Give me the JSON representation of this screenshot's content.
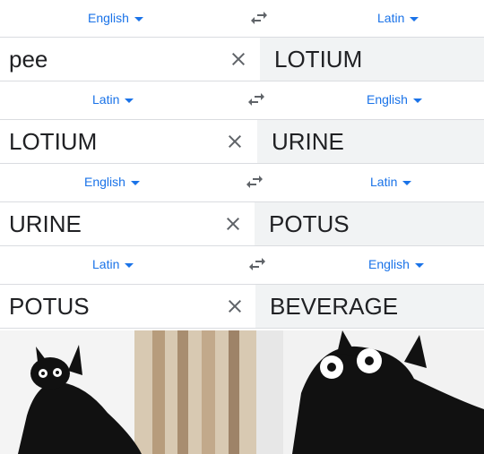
{
  "rows": [
    {
      "source_lang": "English",
      "target_lang": "Latin",
      "source_text": "pee",
      "translation": "LOTIUM"
    },
    {
      "source_lang": "Latin",
      "target_lang": "English",
      "source_text": "LOTIUM",
      "translation": "URINE"
    },
    {
      "source_lang": "English",
      "target_lang": "Latin",
      "source_text": "URINE",
      "translation": "POTUS"
    },
    {
      "source_lang": "Latin",
      "target_lang": "English",
      "source_text": "POTUS",
      "translation": "BEVERAGE"
    }
  ],
  "icons": {
    "swap": "swap-languages-icon",
    "clear": "clear-text-icon",
    "caret": "chevron-down-icon"
  },
  "colors": {
    "language_link": "#1a73e8",
    "translation_background": "#f1f3f4",
    "divider": "#dadce0",
    "icon": "#5f6368",
    "text": "#202124"
  }
}
